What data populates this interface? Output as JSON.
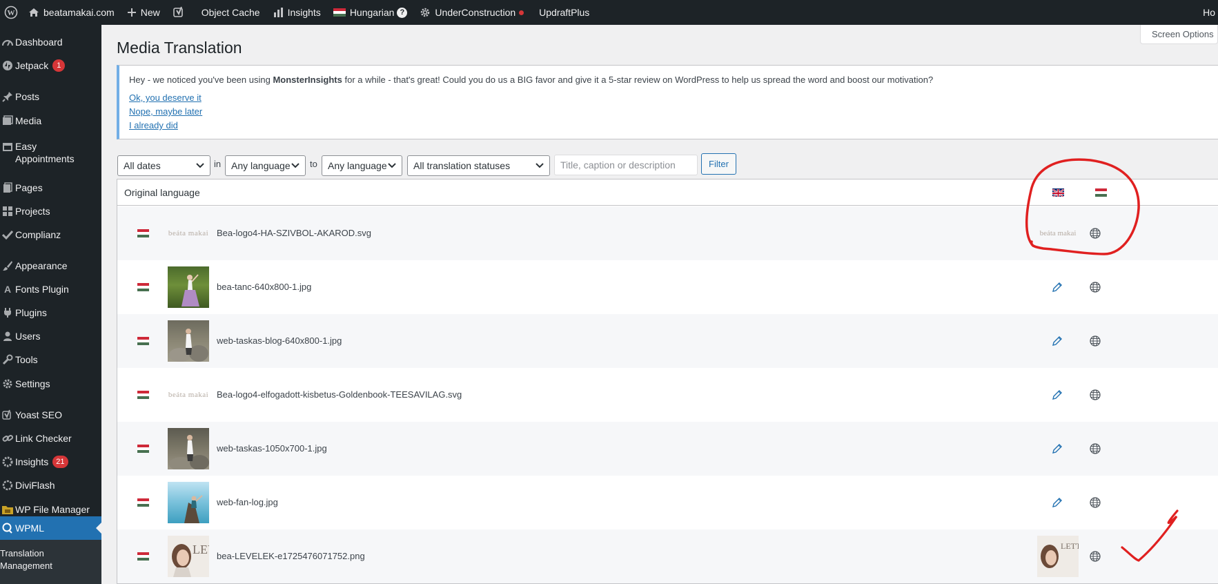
{
  "adminbar": {
    "site_name": "beatamakai.com",
    "new_label": "New",
    "object_cache_label": "Object Cache",
    "insights_label": "Insights",
    "language_label": "Hungarian",
    "help_mark": "?",
    "under_construction_label": "UnderConstruction",
    "updraft_label": "UpdraftPlus",
    "howdy_partial": "Ho"
  },
  "sidebar": {
    "items": [
      {
        "label": "Dashboard",
        "icon": "dashboard-icon"
      },
      {
        "label": "Jetpack",
        "icon": "jetpack-icon",
        "count": "1"
      },
      {
        "label": "Posts",
        "icon": "pin-icon"
      },
      {
        "label": "Media",
        "icon": "media-icon"
      },
      {
        "label": "Easy Appointments",
        "icon": "calendar-icon"
      },
      {
        "label": "Pages",
        "icon": "pages-icon"
      },
      {
        "label": "Projects",
        "icon": "projects-icon"
      },
      {
        "label": "Complianz",
        "icon": "check-icon"
      },
      {
        "label": "Appearance",
        "icon": "brush-icon"
      },
      {
        "label": "Fonts Plugin",
        "icon": "font-icon"
      },
      {
        "label": "Plugins",
        "icon": "plug-icon"
      },
      {
        "label": "Users",
        "icon": "users-icon"
      },
      {
        "label": "Tools",
        "icon": "wrench-icon"
      },
      {
        "label": "Settings",
        "icon": "settings-icon"
      },
      {
        "label": "Yoast SEO",
        "icon": "yoast-icon"
      },
      {
        "label": "Link Checker",
        "icon": "link-icon"
      },
      {
        "label": "Insights",
        "icon": "insights-icon",
        "count": "21"
      },
      {
        "label": "DiviFlash",
        "icon": "diviflash-icon"
      },
      {
        "label": "WP File Manager",
        "icon": "file-manager-icon"
      },
      {
        "label": "WPML",
        "icon": "wpml-icon"
      }
    ],
    "submenu": "Translation Management"
  },
  "screen_options": "Screen Options",
  "page_title": "Media Translation",
  "notice": {
    "text_before": "Hey - we noticed you've been using ",
    "text_bold": "MonsterInsights",
    "text_after": " for a while - that's great! Could you do us a BIG favor and give it a 5-star review on WordPress to help us spread the word and boost our motivation?",
    "links": [
      "Ok, you deserve it",
      "Nope, maybe later",
      "I already did"
    ]
  },
  "filters": {
    "dates": "All dates",
    "in": "in",
    "from_language": "Any language",
    "to": "to",
    "to_language": "Any language",
    "status": "All translation statuses",
    "search_placeholder": "Title, caption or description",
    "filter_button": "Filter"
  },
  "table": {
    "header": "Original language",
    "rows": [
      {
        "file": "Bea-logo4-HA-SZIVBOL-AKAROD.svg",
        "thumb": "logo",
        "en_status": "translated-thumb"
      },
      {
        "file": "bea-tanc-640x800-1.jpg",
        "thumb": "dance",
        "en_status": "edit"
      },
      {
        "file": "web-taskas-blog-640x800-1.jpg",
        "thumb": "rocks",
        "en_status": "edit"
      },
      {
        "file": "Bea-logo4-elfogadott-kisbetus-Goldenbook-TEESAVILAG.svg",
        "thumb": "logo",
        "en_status": "edit"
      },
      {
        "file": "web-taskas-1050x700-1.jpg",
        "thumb": "rocks",
        "en_status": "edit"
      },
      {
        "file": "web-fan-log.jpg",
        "thumb": "sea",
        "en_status": "edit"
      },
      {
        "file": "bea-LEVELEK-e1725476071752.png",
        "thumb": "letter",
        "en_status": "translated-thumb"
      }
    ],
    "logo_text": "beáta makai",
    "letter_text": "LEV",
    "letter_text2": "LETT"
  },
  "colors": {
    "sidebar_bg": "#1d2327",
    "active_menu": "#2271b1",
    "annotation": "#e02020"
  }
}
